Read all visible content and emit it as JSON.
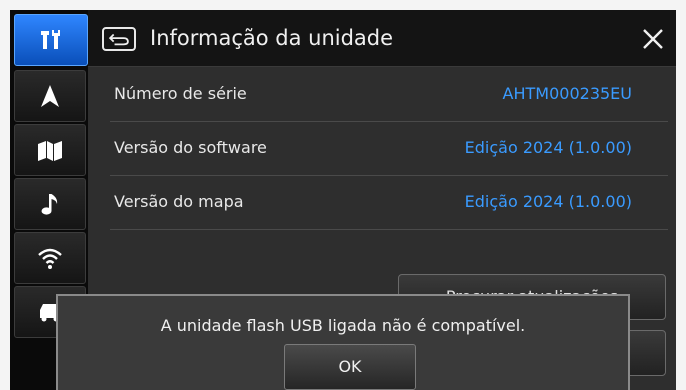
{
  "header": {
    "title": "Informação da unidade",
    "back_icon": "back-arrow-icon",
    "close_icon": "close-icon"
  },
  "sidebar": {
    "items": [
      {
        "name": "settings",
        "icon": "tools-icon",
        "active": true
      },
      {
        "name": "navigation",
        "icon": "navigation-arrow-icon",
        "active": false
      },
      {
        "name": "map",
        "icon": "map-icon",
        "active": false
      },
      {
        "name": "audio",
        "icon": "music-note-icon",
        "active": false
      },
      {
        "name": "connectivity",
        "icon": "wifi-icon",
        "active": false
      },
      {
        "name": "vehicle",
        "icon": "car-icon",
        "active": false
      }
    ]
  },
  "info_rows": [
    {
      "label": "Número de série",
      "value": "AHTM000235EU"
    },
    {
      "label": "Versão do software",
      "value": "Edição 2024 (1.0.00)"
    },
    {
      "label": "Versão do mapa",
      "value": "Edição 2024 (1.0.00)"
    }
  ],
  "partial_button": {
    "label": "Procurar atualizações"
  },
  "dialog": {
    "message": "A unidade flash USB ligada não é compatível.",
    "ok_label": "OK"
  },
  "colors": {
    "accent": "#1a6fe0",
    "value_text": "#3a9bff",
    "background": "#2e2e2e"
  }
}
